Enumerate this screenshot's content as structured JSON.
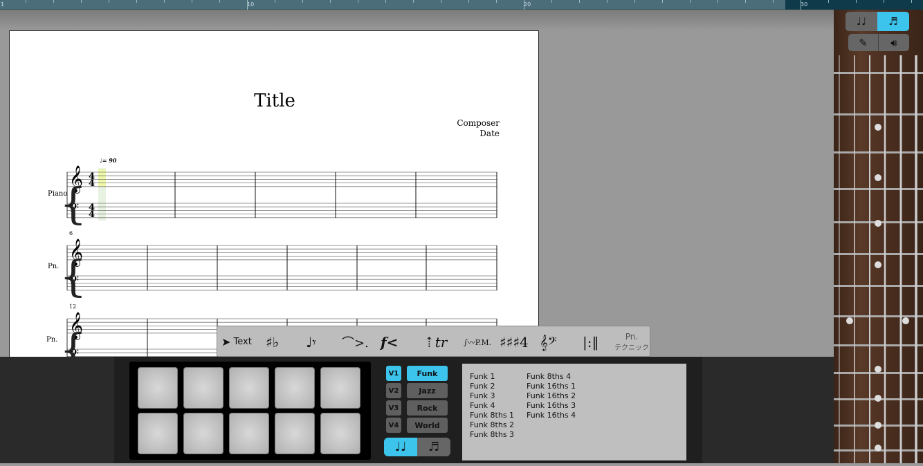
{
  "ruler": {
    "labels": [
      "1",
      "10",
      "20",
      "30"
    ]
  },
  "score": {
    "title": "Title",
    "composer": "Composer",
    "date": "Date",
    "tempo": "= 90",
    "instrument": "Piano",
    "instrument_short": "Pn.",
    "measure_numbers": [
      "6",
      "12"
    ],
    "time_signature": "4/4"
  },
  "palette": {
    "text_label": "Text",
    "technique_top": "Pn.",
    "technique_bottom": "テクニック",
    "items": [
      "text-tool",
      "accidentals",
      "note-rest",
      "articulation",
      "dynamics",
      "ornaments",
      "palm-mute",
      "key-time-signature",
      "clefs",
      "repeat-barline",
      "technique"
    ]
  },
  "top_right": {
    "view_mode": [
      "quarter-notes",
      "sixteenth-notes"
    ],
    "active_view": "sixteenth-notes",
    "tools": [
      "pencil",
      "speaker"
    ]
  },
  "drums": {
    "voices": [
      "V1",
      "V2",
      "V3",
      "V4"
    ],
    "active_voice": "V1",
    "genres": [
      "Funk",
      "Jazz",
      "Rock",
      "World"
    ],
    "active_genre": "Funk",
    "note_mode_active": "quarter-notes",
    "pattern_columns": [
      [
        "Funk 1",
        "Funk 2",
        "Funk 3",
        "Funk 4",
        "Funk 8ths 1",
        "Funk 8ths 2",
        "Funk 8ths 3"
      ],
      [
        "Funk 8ths 4",
        "Funk 16ths 1",
        "Funk 16ths 2",
        "Funk 16ths 3",
        "Funk 16ths 4"
      ]
    ]
  },
  "colors": {
    "accent": "#3cc4ec",
    "ruler": "#4b6c79",
    "background": "#999999"
  }
}
